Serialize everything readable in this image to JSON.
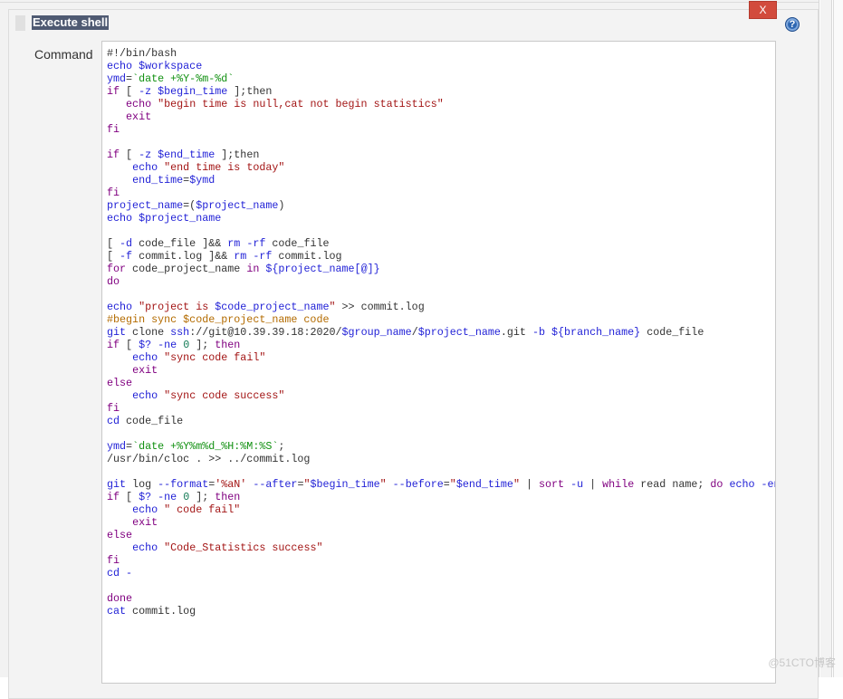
{
  "panel": {
    "title": "Execute shell",
    "close_label": "X",
    "help_label": "?",
    "command_label": "Command"
  },
  "colors": {
    "close": "#d24b3c",
    "title_bg": "#4f5a72",
    "help": "#2e67b2"
  },
  "watermark": "@51CTO博客",
  "code_lines": [
    [
      [
        "d",
        "#!/bin/bash"
      ]
    ],
    [
      [
        "b",
        "echo $workspace"
      ]
    ],
    [
      [
        "b",
        "ymd"
      ],
      [
        "d",
        "="
      ],
      [
        "g",
        "`date +%Y-%m-%d`"
      ]
    ],
    [
      [
        "k",
        "if"
      ],
      [
        "d",
        " [ "
      ],
      [
        "b",
        "-z $begin_time"
      ],
      [
        "d",
        " ];then"
      ]
    ],
    [
      [
        "d",
        "   "
      ],
      [
        "k",
        "echo "
      ],
      [
        "s",
        "\"begin time is null,cat not begin statistics\""
      ]
    ],
    [
      [
        "d",
        "   "
      ],
      [
        "k",
        "exit"
      ]
    ],
    [
      [
        "k",
        "fi"
      ]
    ],
    [],
    [
      [
        "k",
        "if"
      ],
      [
        "d",
        " [ "
      ],
      [
        "b",
        "-z $end_time"
      ],
      [
        "d",
        " ];then"
      ]
    ],
    [
      [
        "d",
        "    "
      ],
      [
        "b",
        "echo "
      ],
      [
        "s",
        "\"end time is today\""
      ]
    ],
    [
      [
        "d",
        "    "
      ],
      [
        "b",
        "end_time"
      ],
      [
        "d",
        "="
      ],
      [
        "b",
        "$ymd"
      ]
    ],
    [
      [
        "k",
        "fi"
      ]
    ],
    [
      [
        "b",
        "project_name"
      ],
      [
        "d",
        "=("
      ],
      [
        "b",
        "$project_name"
      ],
      [
        "d",
        ")"
      ]
    ],
    [
      [
        "b",
        "echo $project_name"
      ]
    ],
    [],
    [
      [
        "d",
        "[ "
      ],
      [
        "b",
        "-d"
      ],
      [
        "d",
        " code_file ]&& "
      ],
      [
        "b",
        "rm -rf"
      ],
      [
        "d",
        " code_file"
      ]
    ],
    [
      [
        "d",
        "[ "
      ],
      [
        "b",
        "-f"
      ],
      [
        "d",
        " commit.log ]&& "
      ],
      [
        "b",
        "rm -rf"
      ],
      [
        "d",
        " commit.log"
      ]
    ],
    [
      [
        "k",
        "for"
      ],
      [
        "d",
        " code_project_name "
      ],
      [
        "k",
        "in"
      ],
      [
        "d",
        " "
      ],
      [
        "b",
        "${project_name[@]}"
      ]
    ],
    [
      [
        "k",
        "do"
      ]
    ],
    [],
    [
      [
        "b",
        "echo "
      ],
      [
        "s",
        "\"project is "
      ],
      [
        "b",
        "$code_project_name"
      ],
      [
        "s",
        "\""
      ],
      [
        "d",
        " >> commit.log"
      ]
    ],
    [
      [
        "c",
        "#begin sync $code_project_name code"
      ]
    ],
    [
      [
        "b",
        "git"
      ],
      [
        "d",
        " clone "
      ],
      [
        "b",
        "ssh"
      ],
      [
        "d",
        "://git@10.39.39.18:2020/"
      ],
      [
        "b",
        "$group_name"
      ],
      [
        "d",
        "/"
      ],
      [
        "b",
        "$project_name"
      ],
      [
        "d",
        ".git "
      ],
      [
        "b",
        "-b ${branch_name}"
      ],
      [
        "d",
        " code_file"
      ]
    ],
    [
      [
        "k",
        "if"
      ],
      [
        "d",
        " [ "
      ],
      [
        "b",
        "$? -ne "
      ],
      [
        "n",
        "0"
      ],
      [
        "d",
        " ]; "
      ],
      [
        "k",
        "then"
      ]
    ],
    [
      [
        "d",
        "    "
      ],
      [
        "b",
        "echo "
      ],
      [
        "s",
        "\"sync code fail\""
      ]
    ],
    [
      [
        "d",
        "    "
      ],
      [
        "k",
        "exit"
      ]
    ],
    [
      [
        "k",
        "else"
      ]
    ],
    [
      [
        "d",
        "    "
      ],
      [
        "b",
        "echo "
      ],
      [
        "s",
        "\"sync code success\""
      ]
    ],
    [
      [
        "k",
        "fi"
      ]
    ],
    [
      [
        "b",
        "cd"
      ],
      [
        "d",
        " code_file"
      ]
    ],
    [],
    [
      [
        "b",
        "ymd"
      ],
      [
        "d",
        "="
      ],
      [
        "g",
        "`date +%Y%m%d_%H:%M:%S`"
      ],
      [
        "d",
        ";"
      ]
    ],
    [
      [
        "d",
        "/usr/bin/cloc . >> ../commit.log"
      ]
    ],
    [],
    [
      [
        "b",
        "git"
      ],
      [
        "d",
        " log "
      ],
      [
        "b",
        "--format"
      ],
      [
        "d",
        "="
      ],
      [
        "s",
        "'%aN'"
      ],
      [
        "d",
        " "
      ],
      [
        "b",
        "--after"
      ],
      [
        "d",
        "="
      ],
      [
        "s",
        "\""
      ],
      [
        "b",
        "$begin_time"
      ],
      [
        "s",
        "\""
      ],
      [
        "d",
        " "
      ],
      [
        "b",
        "--before"
      ],
      [
        "d",
        "="
      ],
      [
        "s",
        "\""
      ],
      [
        "b",
        "$end_time"
      ],
      [
        "s",
        "\""
      ],
      [
        "d",
        " | "
      ],
      [
        "k",
        "sort"
      ],
      [
        "d",
        " "
      ],
      [
        "b",
        "-u"
      ],
      [
        "d",
        " | "
      ],
      [
        "k",
        "while"
      ],
      [
        "d",
        " read name; "
      ],
      [
        "k",
        "do"
      ],
      [
        "d",
        " "
      ],
      [
        "b",
        "echo -en"
      ]
    ],
    [
      [
        "k",
        "if"
      ],
      [
        "d",
        " [ "
      ],
      [
        "b",
        "$? -ne "
      ],
      [
        "n",
        "0"
      ],
      [
        "d",
        " ]; "
      ],
      [
        "k",
        "then"
      ]
    ],
    [
      [
        "d",
        "    "
      ],
      [
        "b",
        "echo "
      ],
      [
        "s",
        "\" code fail\""
      ]
    ],
    [
      [
        "d",
        "    "
      ],
      [
        "k",
        "exit"
      ]
    ],
    [
      [
        "k",
        "else"
      ]
    ],
    [
      [
        "d",
        "    "
      ],
      [
        "b",
        "echo "
      ],
      [
        "s",
        "\"Code_Statistics success\""
      ]
    ],
    [
      [
        "k",
        "fi"
      ]
    ],
    [
      [
        "b",
        "cd -"
      ]
    ],
    [],
    [
      [
        "k",
        "done"
      ]
    ],
    [
      [
        "b",
        "cat"
      ],
      [
        "d",
        " commit.log"
      ]
    ]
  ]
}
